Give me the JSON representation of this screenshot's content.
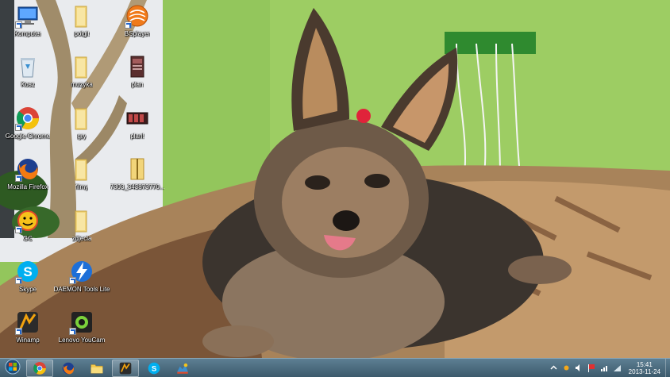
{
  "desktop": {
    "icons": [
      {
        "label": "Komputer",
        "icon": "computer-icon"
      },
      {
        "label": "polgit",
        "icon": "folder-icon"
      },
      {
        "label": "BSplayer",
        "icon": "bsplayer-icon"
      },
      {
        "label": "Kosz",
        "icon": "recycle-bin-icon"
      },
      {
        "label": "muzyka",
        "icon": "folder-icon"
      },
      {
        "label": "plan",
        "icon": "document-icon"
      },
      {
        "label": "Google Chrome",
        "icon": "chrome-icon"
      },
      {
        "label": "gry",
        "icon": "folder-icon"
      },
      {
        "label": "plan!",
        "icon": "document-icon"
      },
      {
        "label": "Mozilla Firefox",
        "icon": "firefox-icon"
      },
      {
        "label": "filmy",
        "icon": "folder-icon"
      },
      {
        "label": "7303_343873770...",
        "icon": "archive-icon"
      },
      {
        "label": "GG",
        "icon": "gg-icon"
      },
      {
        "label": "zdjecia",
        "icon": "folder-icon"
      },
      {
        "label": "Skype",
        "icon": "skype-icon"
      },
      {
        "label": "DAEMON Tools Lite",
        "icon": "daemon-tools-icon"
      },
      {
        "label": "Winamp",
        "icon": "winamp-icon"
      },
      {
        "label": "Lenovo YouCam",
        "icon": "webcam-icon"
      }
    ]
  },
  "taskbar": {
    "start_icon": "windows-logo-icon",
    "pinned": [
      {
        "name": "chrome",
        "icon": "chrome-icon"
      },
      {
        "name": "firefox",
        "icon": "firefox-icon"
      },
      {
        "name": "explorer",
        "icon": "folder-icon"
      },
      {
        "name": "winamp",
        "icon": "winamp-icon"
      },
      {
        "name": "skype",
        "icon": "skype-icon"
      },
      {
        "name": "paint",
        "icon": "paint-icon"
      }
    ],
    "clock": {
      "time": "15:41",
      "date": "2013-11-24"
    }
  },
  "colors": {
    "wall": "#8fc35a",
    "taskbar": "#4a6a7d",
    "blanket": "#b08a62"
  }
}
